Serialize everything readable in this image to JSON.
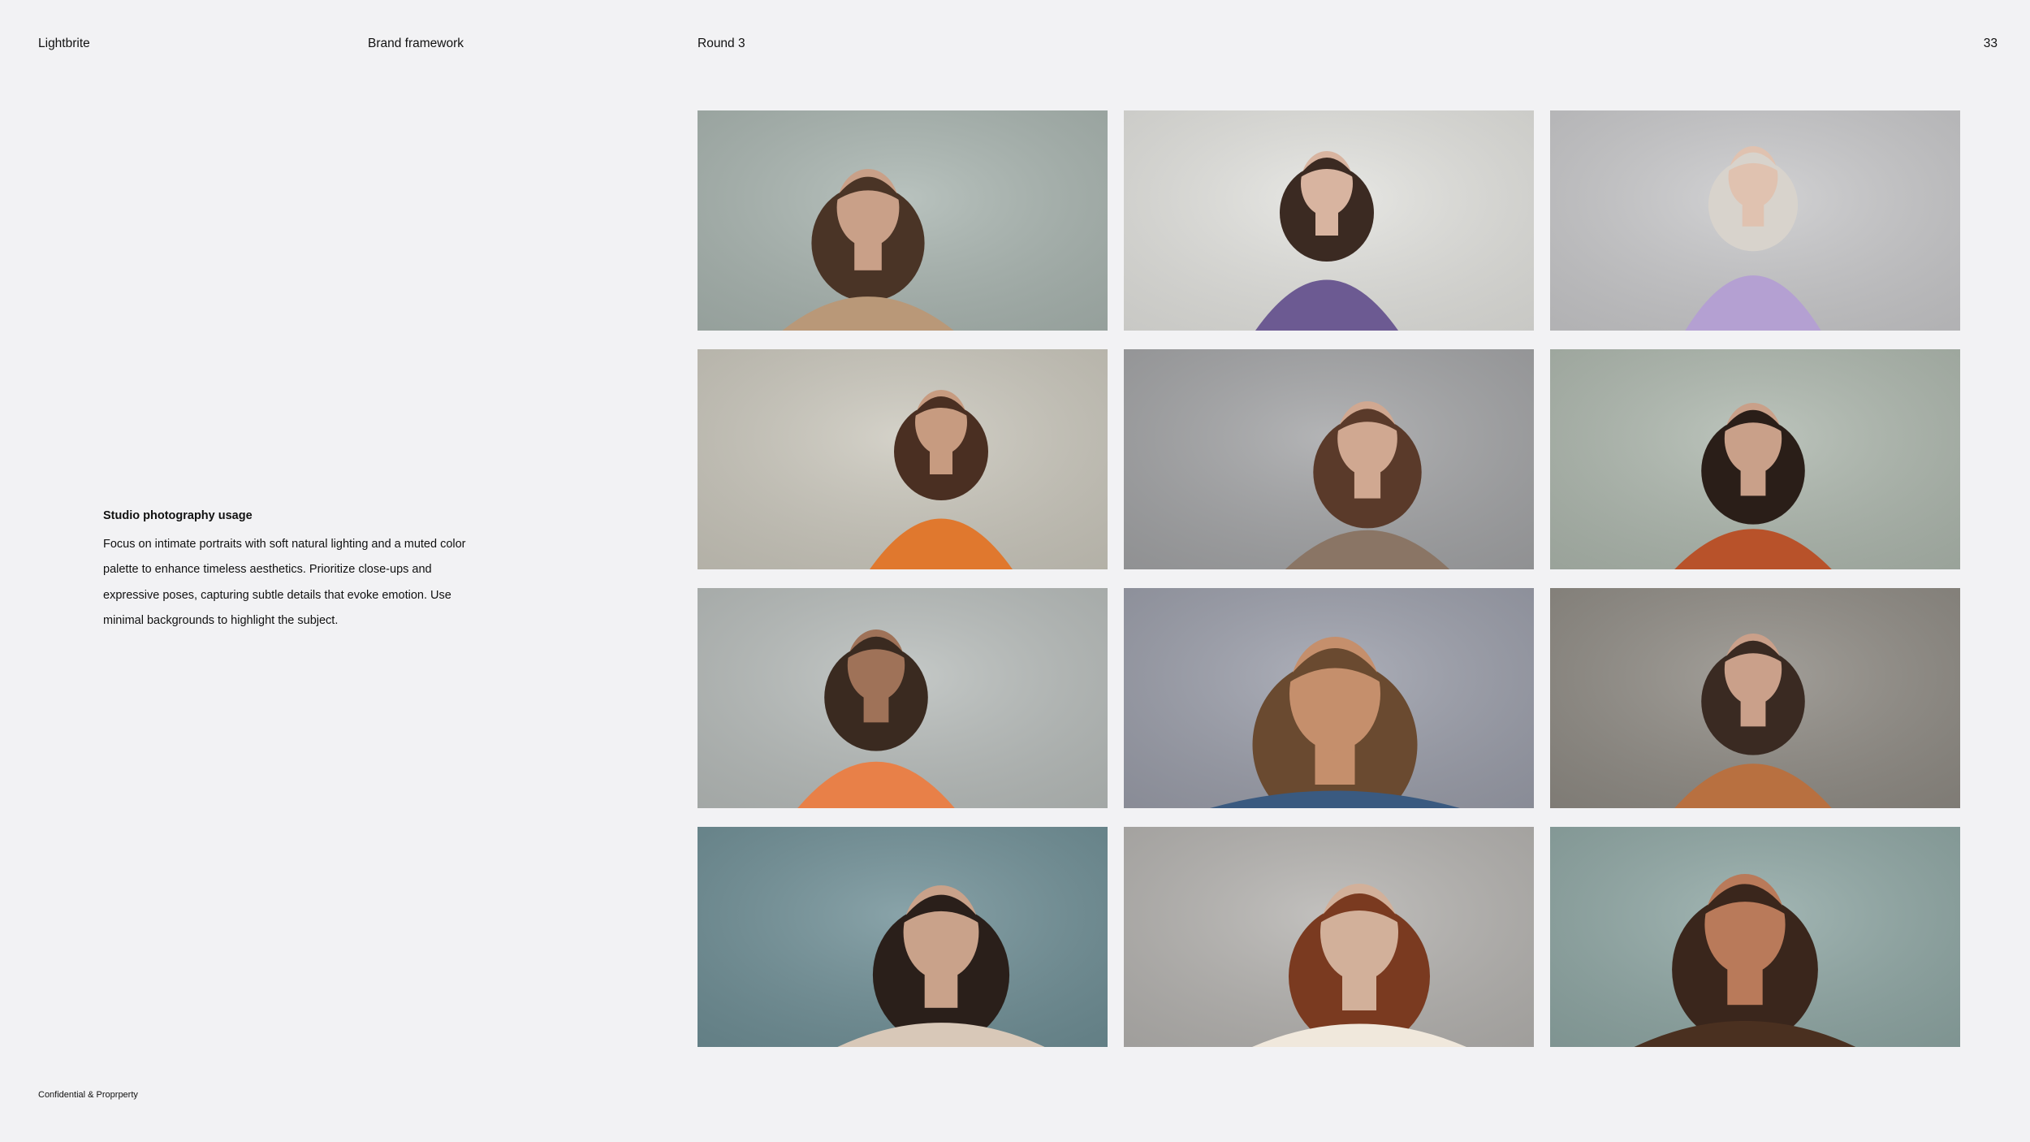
{
  "header": {
    "brand": "Lightbrite",
    "document": "Brand framework",
    "round": "Round 3",
    "page_number": "33"
  },
  "copy": {
    "title": "Studio photography usage",
    "body": "Focus on intimate portraits with soft natural lighting and a muted color palette to enhance timeless aesthetics. Prioritize close-ups and expressive poses, capturing subtle details that evoke emotion. Use minimal backgrounds to highlight the subject."
  },
  "footer": {
    "label": "Confidential & Proprperty"
  },
  "photos": [
    {
      "name": "photo-woman-wavy-hair-beige-sweater",
      "bg": "#a9b5b0",
      "hair": "#4a3426",
      "skin": "#c9a088",
      "top": "#b99878"
    },
    {
      "name": "photo-woman-profile-phone-purple-top",
      "bg": "#e3e3df",
      "hair": "#3b2a22",
      "skin": "#d8b4a0",
      "top": "#6c5a92"
    },
    {
      "name": "photo-woman-short-blonde-lavender-sweater",
      "bg": "#c9c9cb",
      "hair": "#d8d3cc",
      "skin": "#e0c2b0",
      "top": "#b4a0d2"
    },
    {
      "name": "photo-woman-curly-bun-phone-orange-blouse",
      "bg": "#cbc8bd",
      "hair": "#4a2f22",
      "skin": "#c79b80",
      "top": "#e0782e"
    },
    {
      "name": "photo-woman-hair-over-face-knit-sweater",
      "bg": "#a3a4a6",
      "hair": "#5a3a2a",
      "skin": "#d0a891",
      "top": "#8a7565"
    },
    {
      "name": "photo-woman-bun-rust-sweater",
      "bg": "#aeb8ae",
      "hair": "#2a1e18",
      "skin": "#c9a089",
      "top": "#b8522a"
    },
    {
      "name": "photo-woman-tousled-hair-orange-bow",
      "bg": "#b8bdbb",
      "hair": "#3a2a20",
      "skin": "#9f7258",
      "top": "#e88048"
    },
    {
      "name": "photo-man-closeup-blue-sweater",
      "bg": "#9b9eaa",
      "hair": "#6a4a30",
      "skin": "#c58f6c",
      "top": "#3a5a80"
    },
    {
      "name": "photo-woman-bangs-orange-hoodie",
      "bg": "#8f8b84",
      "hair": "#3a2a22",
      "skin": "#caa08a",
      "top": "#b87040"
    },
    {
      "name": "photo-woman-dark-hair-ring-profile",
      "bg": "#6f8f96",
      "hair": "#2a1f1a",
      "skin": "#c9a28a",
      "top": "#d8c8b8"
    },
    {
      "name": "photo-woman-hand-on-face-red-hair",
      "bg": "#b5b3b0",
      "hair": "#7a3a20",
      "skin": "#d2b09a",
      "top": "#f0e8dc"
    },
    {
      "name": "photo-woman-freckles-hand-ring",
      "bg": "#8fa7a4",
      "hair": "#3a261c",
      "skin": "#b97a5a",
      "top": "#4a3020"
    }
  ]
}
